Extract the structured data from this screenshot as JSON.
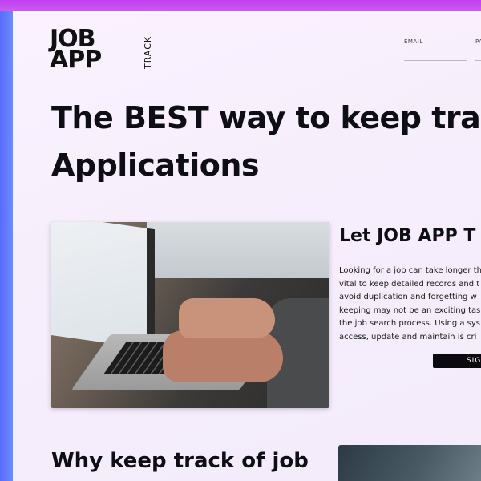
{
  "logo": {
    "line1": "JOB",
    "line2": "APP",
    "track": "TRACK"
  },
  "login": {
    "email_label": "EMAIL",
    "password_label": "PA"
  },
  "hero": {
    "headline_line1": "The BEST way to keep track",
    "headline_line2": "Applications"
  },
  "intro": {
    "title": "Let JOB APP T",
    "body_lines": [
      "Looking for a job can take longer th",
      "vital to keep detailed records and t",
      "avoid duplication and forgetting w",
      "keeping may not be an exciting tas",
      "the job search process. Using a sys",
      "access, update and maintain is cri"
    ],
    "signup_label": "SIGN"
  },
  "why": {
    "title": "Why keep track of job"
  }
}
